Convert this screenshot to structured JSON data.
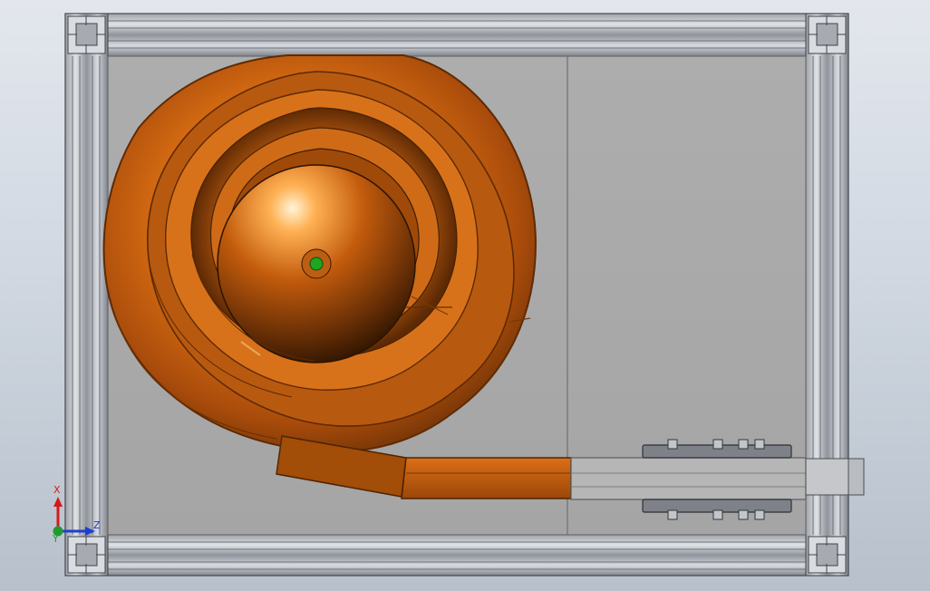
{
  "app": {
    "view_name": "",
    "background_gradient": [
      "#e3e7ed",
      "#d1d8e2",
      "#b7c0cb"
    ]
  },
  "model": {
    "frame_color": "#a8acb3",
    "panel_color": "#a9a9a9",
    "bowl_color": "#d9751e",
    "bowl_dark": "#6b3205",
    "bowl_light": "#ffd7a8",
    "track_color": "#c5620f",
    "center_marker_color": "#1ea61e"
  },
  "triad": {
    "x_label": "X",
    "y_label": "Y",
    "z_label": "Z"
  }
}
